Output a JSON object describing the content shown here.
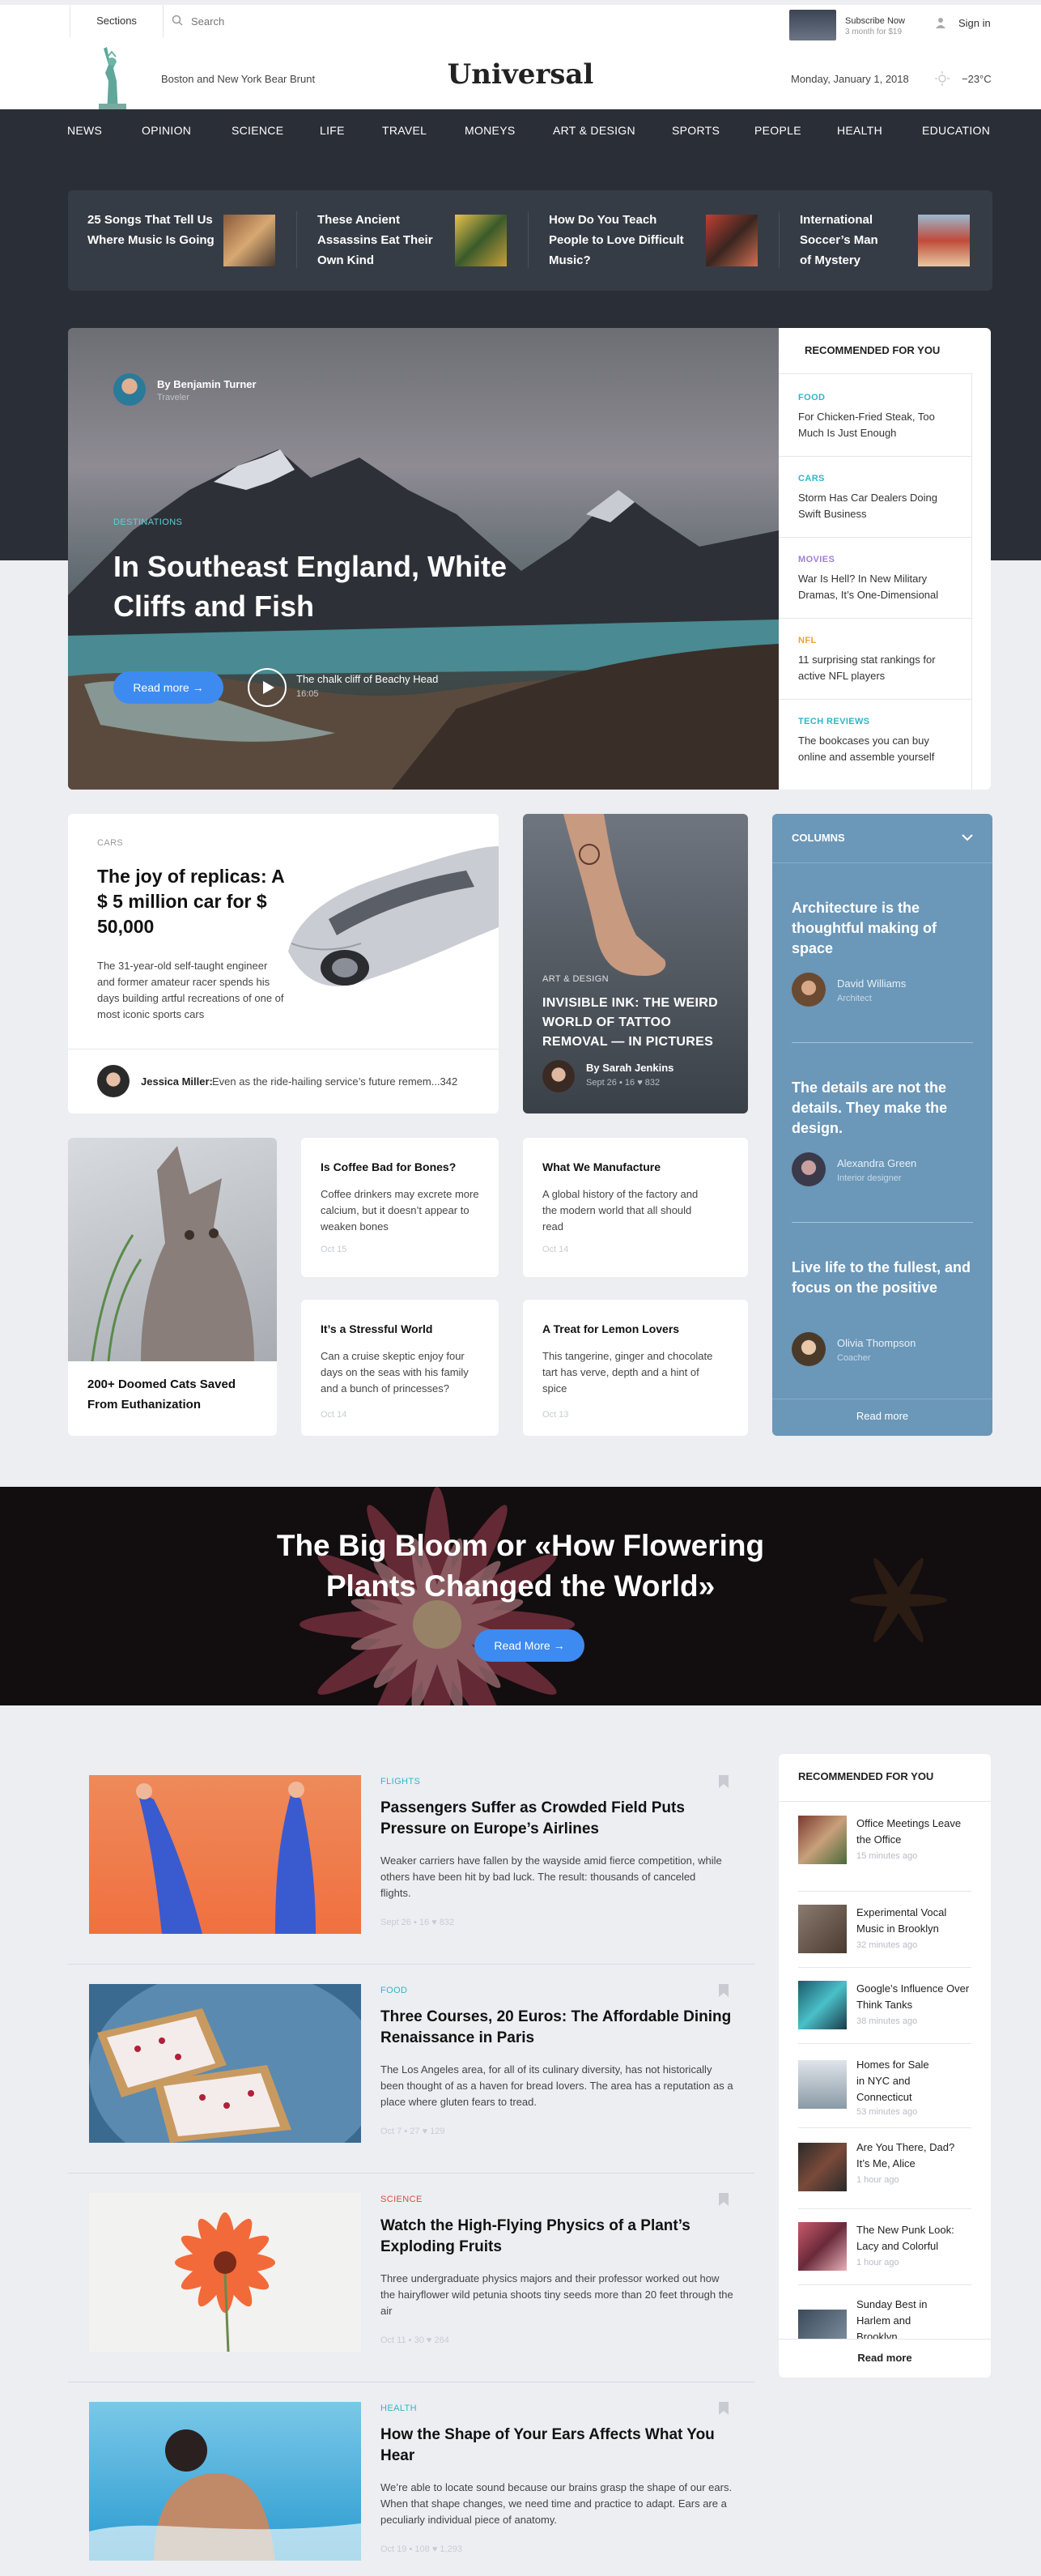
{
  "header": {
    "sections": "Sections",
    "search_placeholder": "Search",
    "subscribe_title": "Subscribe Now",
    "subscribe_sub": "3 month for $19",
    "signin": "Sign in",
    "tagline": "Boston and New York Bear Brunt",
    "logo": "Universal",
    "date": "Monday, January 1, 2018",
    "temp": "−23°C"
  },
  "nav": [
    "NEWS",
    "OPINION",
    "SCIENCE",
    "LIFE",
    "TRAVEL",
    "MONEYS",
    "ART & DESIGN",
    "SPORTS",
    "PEOPLE",
    "HEALTH",
    "EDUCATION"
  ],
  "ticker": [
    {
      "title": "25 Songs That Tell Us Where Music Is Going"
    },
    {
      "title": "These Ancient Assassins Eat Their Own Kind"
    },
    {
      "title": "How Do You Teach People to Love Difficult Music?"
    },
    {
      "title": "International Soccer’s Man of Mystery"
    }
  ],
  "hero": {
    "author": "By Benjamin Turner",
    "author_role": "Traveler",
    "tag": "DESTINATIONS",
    "title": "In Southeast England, White Cliffs and Fish",
    "read_more": "Read more  →",
    "video_title": "The chalk cliff of Beachy Head",
    "video_time": "16:05"
  },
  "rec_top": {
    "title": "RECOMMENDED FOR YOU",
    "items": [
      {
        "tag": "FOOD",
        "text": "For Chicken-Fried Steak, Too Much Is Just Enough",
        "color": "#2fb6c8"
      },
      {
        "tag": "CARS",
        "text": "Storm Has Car Dealers Doing Swift Business",
        "color": "#2fb6c8"
      },
      {
        "tag": "MOVIES",
        "text": "War Is Hell? In New Military Dramas, It’s One-Dimensional",
        "color": "#a07fd6"
      },
      {
        "tag": "NFL",
        "text": "11 surprising stat rankings for active NFL players",
        "color": "#f0a030"
      },
      {
        "tag": "TECH REVIEWS",
        "text": "The bookcases you can buy online and assemble yourself",
        "color": "#2fb6c8"
      }
    ]
  },
  "cars": {
    "tag": "CARS",
    "title": "The joy of replicas: A $ 5 million car for $ 50,000",
    "desc": "The 31-year-old self-taught engineer and former amateur racer spends his days building artful recreations of one of most iconic sports cars",
    "quote_author": "Jessica Miller:",
    "quote": "Even as the ride-hailing service’s future remem...342"
  },
  "ink": {
    "tag": "ART & DESIGN",
    "title": "INVISIBLE INK: THE WEIRD WORLD OF TATTOO REMOVAL — IN PICTURES",
    "author": "By Sarah Jenkins",
    "meta": "Sept 26  ▪ 16  ♥ 832"
  },
  "columns": {
    "title": "COLUMNS",
    "items": [
      {
        "title": "Architecture is the thoughtful making of space",
        "author": "David Williams",
        "role": "Architect"
      },
      {
        "title": "The details are not the details. They make the design.",
        "author": "Alexandra Green",
        "role": "Interior designer"
      },
      {
        "title": "Live life to the fullest, and focus on the positive",
        "author": "Olivia Thompson",
        "role": "Coacher"
      }
    ],
    "read_more": "Read more"
  },
  "cats": {
    "title": "200+ Doomed Cats Saved From Euthanization"
  },
  "minis": [
    {
      "title": "Is Coffee Bad for Bones?",
      "desc": "Coffee drinkers may excrete more calcium, but it doesn’t appear to weaken bones",
      "date": "Oct 15"
    },
    {
      "title": "What We Manufacture",
      "desc": "A global history of the factory and the modern world that all should read",
      "date": "Oct 14"
    },
    {
      "title": "It’s a Stressful World",
      "desc": "Can a cruise skeptic enjoy four days on the seas with his family and a bunch of princesses?",
      "date": "Oct 14"
    },
    {
      "title": "A Treat for Lemon Lovers",
      "desc": "This tangerine, ginger and chocolate tart has verve, depth and a hint of spice",
      "date": "Oct 13"
    }
  ],
  "bloom": {
    "title": "The Big Bloom or «How Flowering Plants Changed the World»",
    "read_more": "Read More  →"
  },
  "feed": [
    {
      "tag": "FLIGHTS",
      "color": "#2fb6c8",
      "title": "Passengers Suffer as Crowded Field Puts Pressure on Europe’s Airlines",
      "desc": "Weaker carriers have fallen by the wayside amid fierce competition, while others have been hit by bad luck. The result: thousands of canceled flights.",
      "meta": "Sept 26  ▪ 16  ♥ 832"
    },
    {
      "tag": "FOOD",
      "color": "#2fb6c8",
      "title": "Three Courses, 20 Euros: The Affordable Dining Renaissance in Paris",
      "desc": "The Los Angeles area, for all of its culinary diversity, has not historically been thought of as a haven for bread lovers. The area has a reputation as a place where gluten fears to tread.",
      "meta": "Oct 7  ▪ 27  ♥ 129"
    },
    {
      "tag": "SCIENCE",
      "color": "#e04a3a",
      "title": "Watch the High-Flying Physics of a Plant’s Exploding Fruits",
      "desc": "Three undergraduate physics majors and their professor worked out how the hairyflower wild petunia shoots tiny seeds more than 20 feet through the air",
      "meta": "Oct 11  ▪ 30  ♥ 264"
    },
    {
      "tag": "HEALTH",
      "color": "#2fb6c8",
      "title": "How the Shape of Your Ears Affects What You Hear",
      "desc": "We’re able to locate sound because our brains grasp the shape of our ears. When that shape changes, we need time and practice to adapt. Ears are a peculiarly individual piece of anatomy.",
      "meta": "Oct 19  ▪ 108  ♥ 1,293"
    }
  ],
  "rec_side": {
    "title": "RECOMMENDED FOR YOU",
    "items": [
      {
        "title": "Office Meetings Leave the Office",
        "time": "15 minutes ago"
      },
      {
        "title": "Experimental Vocal Music in Brooklyn",
        "time": "32 minutes ago"
      },
      {
        "title": "Google’s Influence Over Think Tanks",
        "time": "38 minutes ago"
      },
      {
        "title": "Homes for Sale in NYC and Connecticut",
        "time": "53 minutes ago"
      },
      {
        "title": "Are You There, Dad? It’s Me, Alice",
        "time": "1 hour ago"
      },
      {
        "title": "The New Punk Look: Lacy and Colorful",
        "time": "1 hour ago"
      },
      {
        "title": "Sunday Best in Harlem and Brooklyn",
        "time": ""
      }
    ],
    "read_more": "Read more"
  }
}
